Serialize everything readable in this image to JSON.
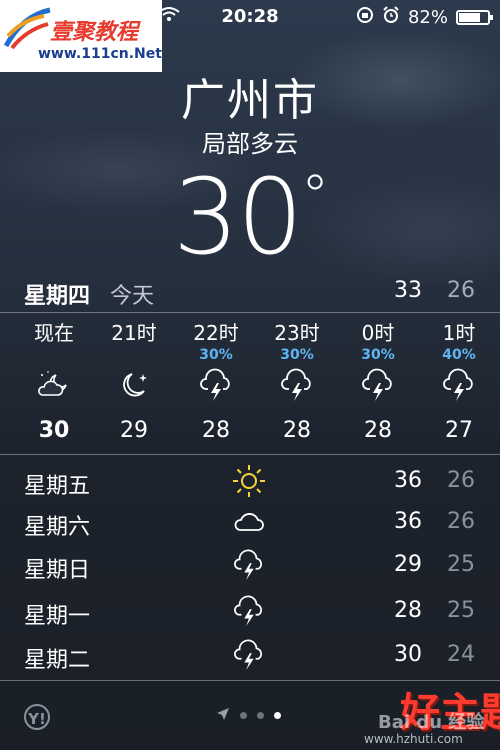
{
  "status_bar": {
    "time": "20:28",
    "battery_text": "82%",
    "battery_level": 0.82,
    "icons": [
      "wifi-icon",
      "rotation-lock-icon",
      "alarm-icon",
      "battery-icon"
    ]
  },
  "watermark_logo": {
    "brand": "壹聚教程",
    "url": "www.111cn.Net"
  },
  "header": {
    "city": "广州市",
    "condition": "局部多云",
    "temperature": "30",
    "degree_symbol": "°"
  },
  "today": {
    "day": "星期四",
    "label": "今天",
    "high": "33",
    "low": "26"
  },
  "hourly": [
    {
      "time": "现在",
      "precip": "",
      "icon": "night-partly-cloudy-icon",
      "temp": "30"
    },
    {
      "time": "21时",
      "precip": "",
      "icon": "moon-stars-icon",
      "temp": "29"
    },
    {
      "time": "22时",
      "precip": "30%",
      "icon": "thunderstorm-icon",
      "temp": "28"
    },
    {
      "time": "23时",
      "precip": "30%",
      "icon": "thunderstorm-icon",
      "temp": "28"
    },
    {
      "time": "0时",
      "precip": "30%",
      "icon": "thunderstorm-icon",
      "temp": "28"
    },
    {
      "time": "1时",
      "precip": "40%",
      "icon": "thunderstorm-icon",
      "temp": "27"
    }
  ],
  "daily": [
    {
      "day": "星期五",
      "icon": "sun-icon",
      "high": "36",
      "low": "26"
    },
    {
      "day": "星期六",
      "icon": "cloud-icon",
      "high": "36",
      "low": "26"
    },
    {
      "day": "星期日",
      "icon": "thunderstorm-icon",
      "high": "29",
      "low": "25"
    },
    {
      "day": "星期一",
      "icon": "thunderstorm-icon",
      "high": "28",
      "low": "25"
    },
    {
      "day": "星期二",
      "icon": "thunderstorm-icon",
      "high": "30",
      "low": "24"
    }
  ],
  "footer": {
    "yahoo_logo": "Y!",
    "page_dots": 3,
    "active_dot": 2
  },
  "watermark_bottom": {
    "big": "好主题",
    "baidu": "Bai du 经验",
    "url": "www.hzhuti.com"
  },
  "colors": {
    "precip": "#5fb4f2",
    "sun": "#f7d23a",
    "watermark_red": "#ff3b30"
  }
}
